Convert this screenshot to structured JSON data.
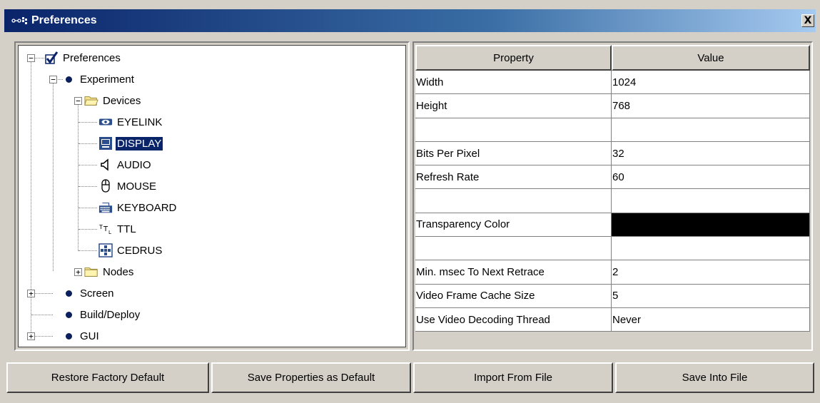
{
  "window": {
    "title": "Preferences",
    "close_label": "X"
  },
  "tree": {
    "root": "Preferences",
    "experiment": "Experiment",
    "devices": "Devices",
    "device_items": [
      "EYELINK",
      "DISPLAY",
      "AUDIO",
      "MOUSE",
      "KEYBOARD",
      "TTL",
      "CEDRUS"
    ],
    "nodes": "Nodes",
    "screen": "Screen",
    "build_deploy": "Build/Deploy",
    "gui": "GUI",
    "selected": "DISPLAY"
  },
  "properties": {
    "headers": {
      "property": "Property",
      "value": "Value"
    },
    "rows": [
      {
        "property": "Width",
        "value": "1024"
      },
      {
        "property": "Height",
        "value": "768"
      },
      {
        "property": "",
        "value": ""
      },
      {
        "property": "Bits Per Pixel",
        "value": "32"
      },
      {
        "property": "Refresh Rate",
        "value": "60"
      },
      {
        "property": "",
        "value": ""
      },
      {
        "property": "Transparency Color",
        "value": "",
        "color": "#000000"
      },
      {
        "property": "",
        "value": ""
      },
      {
        "property": "Min. msec To Next Retrace",
        "value": "2"
      },
      {
        "property": "Video Frame Cache Size",
        "value": "5"
      },
      {
        "property": "Use Video Decoding Thread",
        "value": "Never"
      }
    ]
  },
  "buttons": {
    "restore": "Restore Factory Default",
    "save_default": "Save Properties as Default",
    "import": "Import From File",
    "save_file": "Save Into File"
  },
  "colors": {
    "titlebar_start": "#0a246a",
    "selection": "#0a246a",
    "face": "#d4d0c8"
  }
}
